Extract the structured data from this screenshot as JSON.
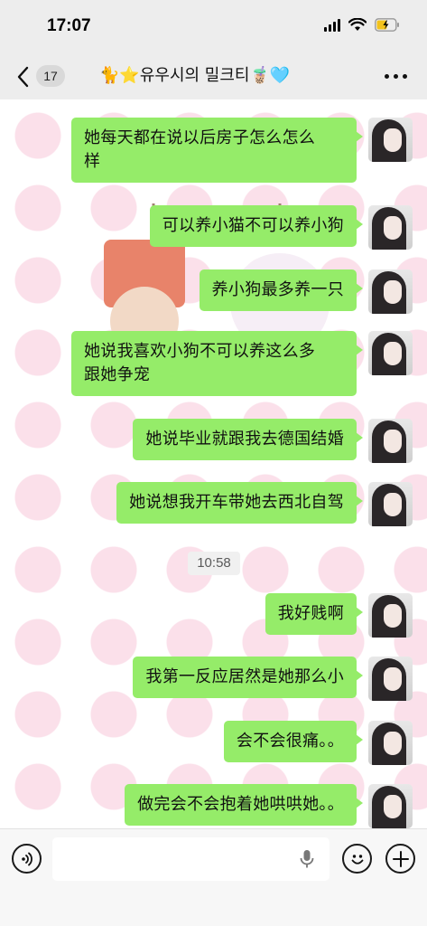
{
  "status_bar": {
    "time": "17:07"
  },
  "nav": {
    "unread_count": "17",
    "title": "🐈⭐유우시의 밀크티🧋🩵"
  },
  "timestamp": "10:58",
  "messages": [
    {
      "text_lines": [
        "她每天都在说以后房子怎么怎么",
        "样"
      ]
    },
    {
      "text_lines": [
        "可以养小猫不可以养小狗"
      ]
    },
    {
      "text_lines": [
        "养小狗最多养一只"
      ]
    },
    {
      "text_lines": [
        "她说我喜欢小狗不可以养这么多",
        "跟她争宠"
      ]
    },
    {
      "text_lines": [
        "她说毕业就跟我去德国结婚"
      ]
    },
    {
      "text_lines": [
        "她说想我开车带她去西北自驾"
      ]
    },
    {
      "text_lines": [
        "我好贱啊"
      ]
    },
    {
      "text_lines": [
        "我第一反应居然是她那么小"
      ]
    },
    {
      "text_lines": [
        "会不会很痛。。"
      ]
    },
    {
      "text_lines": [
        "做完会不会抱着她哄哄她。。"
      ]
    }
  ],
  "input": {
    "value": "",
    "placeholder": ""
  },
  "colors": {
    "bubble": "#95ec69",
    "header_bg": "#ededed",
    "polka_dot": "#fbe0ea"
  }
}
